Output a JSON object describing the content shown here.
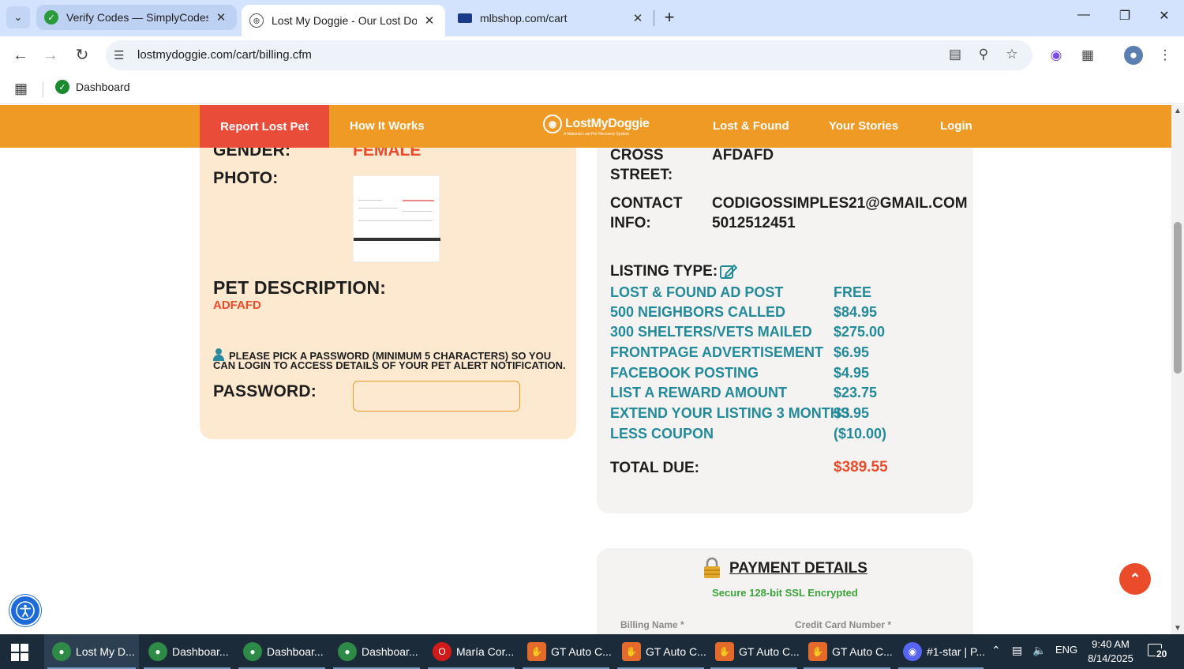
{
  "browser": {
    "tabs": [
      {
        "title": "Verify Codes — SimplyCodes",
        "icon": "simplycodes-icon"
      },
      {
        "title": "Lost My Doggie - Our Lost Dog",
        "icon": "globe-icon"
      },
      {
        "title": "mlbshop.com/cart",
        "icon": "mlb-icon"
      }
    ],
    "url": "lostmydoggie.com/cart/billing.cfm",
    "bookmark": "Dashboard"
  },
  "site_nav": {
    "report": "Report Lost Pet",
    "how": "How It Works",
    "logo": "LostMyDoggie",
    "logo_tag": "A National Lost Pet Recovery System",
    "lost_found": "Lost & Found",
    "stories": "Your Stories",
    "login": "Login"
  },
  "pet": {
    "gender_label": "GENDER:",
    "gender": "FEMALE",
    "photo_label": "PHOTO:",
    "desc_label": "PET DESCRIPTION:",
    "desc": "ADFAFD",
    "pw_note": "PLEASE PICK A PASSWORD (MINIMUM 5 CHARACTERS) SO YOU CAN LOGIN TO ACCESS DETAILS OF YOUR PET ALERT NOTIFICATION.",
    "pw_label": "PASSWORD:",
    "pw_value": ""
  },
  "contact": {
    "cross_label_1": "CROSS",
    "cross_label_2": "STREET:",
    "cross_value": "AFDAFD",
    "contact_label_1": "CONTACT",
    "contact_label_2": "INFO:",
    "email": "CODIGOSSIMPLES21@GMAIL.COM",
    "phone": "5012512451"
  },
  "listing": {
    "label": "LISTING TYPE:",
    "items": [
      {
        "name": "LOST & FOUND AD POST",
        "price": "FREE"
      },
      {
        "name": "500 NEIGHBORS CALLED",
        "price": "$84.95"
      },
      {
        "name": "300 SHELTERS/VETS MAILED",
        "price": "$275.00"
      },
      {
        "name": "FRONTPAGE ADVERTISEMENT",
        "price": "$6.95"
      },
      {
        "name": "FACEBOOK POSTING",
        "price": "$4.95"
      },
      {
        "name": "LIST A REWARD AMOUNT",
        "price": "$23.75"
      },
      {
        "name": "EXTEND YOUR LISTING 3 MONTHS",
        "price": "$3.95"
      },
      {
        "name": "LESS COUPON",
        "price": "($10.00)"
      }
    ],
    "total_label": "TOTAL DUE:",
    "total": "$389.55"
  },
  "payment": {
    "title": "PAYMENT DETAILS",
    "ssl": "Secure 128-bit SSL Encrypted",
    "billing_name": "Billing Name *",
    "card_number": "Credit Card Number *"
  },
  "taskbar": {
    "apps": [
      {
        "label": "Lost My D..."
      },
      {
        "label": "Dashboar..."
      },
      {
        "label": "Dashboar..."
      },
      {
        "label": "Dashboar..."
      },
      {
        "label": "María Cor..."
      },
      {
        "label": "GT Auto C..."
      },
      {
        "label": "GT Auto C..."
      },
      {
        "label": "GT Auto C..."
      },
      {
        "label": "GT Auto C..."
      },
      {
        "label": "#1-star | P..."
      }
    ],
    "lang": "ENG",
    "time": "9:40 AM",
    "date": "8/14/2025",
    "notifications": "20"
  },
  "colors": {
    "nav_orange": "#f09a26",
    "report_red": "#ea4c3a",
    "teal": "#238a9a",
    "price_red": "#ea4c2b"
  }
}
